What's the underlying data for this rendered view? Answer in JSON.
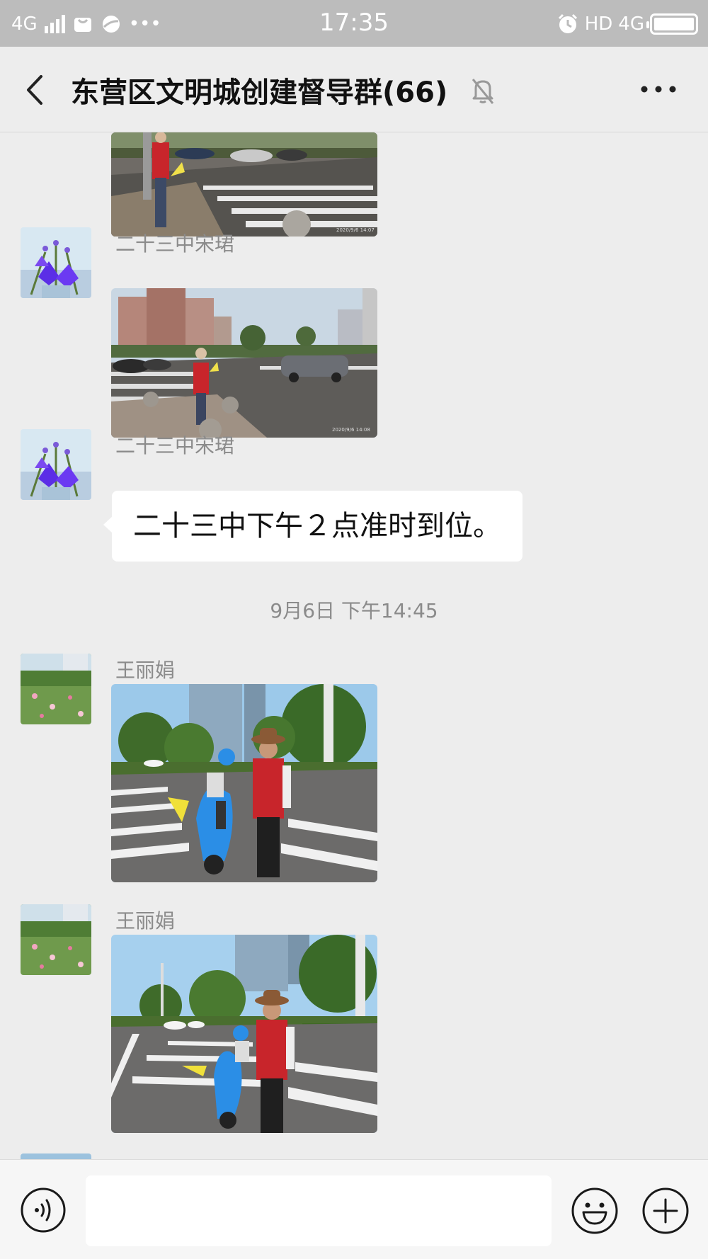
{
  "status_bar": {
    "network": "4G",
    "time": "17:35",
    "hd": "HD",
    "network_right": "4G"
  },
  "header": {
    "title": "东营区文明城创建督导群(66)",
    "icons": [
      "back-arrow-icon",
      "mute-bell-icon",
      "more-icon"
    ]
  },
  "messages": [
    {
      "type": "image",
      "sender": "",
      "photo_stamp": "2020/9/6 14:07"
    },
    {
      "type": "image",
      "sender": "二十三中宋珺",
      "photo_stamp": "2020/9/6 14:08"
    },
    {
      "type": "text",
      "sender": "二十三中宋珺",
      "text": "二十三中下午２点准时到位。"
    },
    {
      "type": "image",
      "sender": "王丽娟"
    },
    {
      "type": "image",
      "sender": "王丽娟"
    }
  ],
  "timestamp_divider": "9月6日 下午14:45",
  "input_bar": {
    "value": "",
    "icons": [
      "voice-icon",
      "emoji-icon",
      "plus-icon"
    ]
  },
  "colors": {
    "background": "#ededed",
    "status_bar": "#bcbcbc",
    "bubble": "#ffffff",
    "vest_red": "#c8252b",
    "scooter_blue": "#2b8ee6"
  }
}
